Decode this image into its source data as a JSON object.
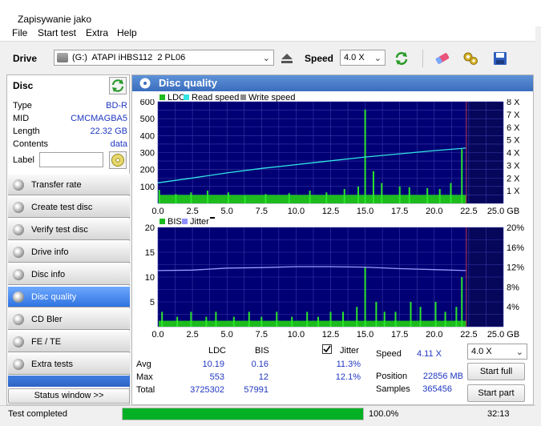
{
  "window": {
    "title": "Zapisywanie jako"
  },
  "menu": [
    "File",
    "Start test",
    "Extra",
    "Help"
  ],
  "toolbar": {
    "drive_label": "Drive",
    "drive_value": "(G:)  ATAPI iHBS112  2 PL06",
    "speed_label": "Speed",
    "speed_value": "4.0 X"
  },
  "disc": {
    "title": "Disc",
    "rows": [
      {
        "label": "Type",
        "value": "BD-R"
      },
      {
        "label": "MID",
        "value": "CMCMAGBA5"
      },
      {
        "label": "Length",
        "value": "22.32 GB"
      },
      {
        "label": "Contents",
        "value": "data"
      }
    ],
    "label_label": "Label",
    "label_value": ""
  },
  "nav": [
    {
      "label": "Transfer rate",
      "active": false
    },
    {
      "label": "Create test disc",
      "active": false
    },
    {
      "label": "Verify test disc",
      "active": false
    },
    {
      "label": "Drive info",
      "active": false
    },
    {
      "label": "Disc info",
      "active": false
    },
    {
      "label": "Disc quality",
      "active": true
    },
    {
      "label": "CD Bler",
      "active": false
    },
    {
      "label": "FE / TE",
      "active": false
    },
    {
      "label": "Extra tests",
      "active": false
    }
  ],
  "status_window_button": "Status window >>",
  "panel_title": "Disc quality",
  "chart_data": [
    {
      "type": "bar",
      "legend": [
        "LDC",
        "Read speed",
        "Write speed"
      ],
      "colors": {
        "LDC": "#1dbb1d",
        "Read speed": "#33e3e3",
        "Write speed": "#8a8a8a"
      },
      "x_ticks": [
        "0.0",
        "2.5",
        "5.0",
        "7.5",
        "10.0",
        "12.5",
        "15.0",
        "17.5",
        "20.0",
        "22.5",
        "25.0 GB"
      ],
      "y_ticks_left": [
        "600",
        "500",
        "400",
        "300",
        "200",
        "100"
      ],
      "y_ticks_right": [
        "8 X",
        "7 X",
        "6 X",
        "5 X",
        "4 X",
        "3 X",
        "2 X",
        "1 X"
      ],
      "xlim": [
        0,
        25
      ],
      "ylim": [
        0,
        600
      ],
      "y2lim": [
        0,
        8
      ],
      "data_end_gb": 22.32,
      "ldc_baseline_approx": 50,
      "ldc_spikes": [
        [
          0.1,
          80
        ],
        [
          1.3,
          55
        ],
        [
          2.4,
          65
        ],
        [
          3.6,
          75
        ],
        [
          5.1,
          65
        ],
        [
          6.3,
          45
        ],
        [
          7.8,
          55
        ],
        [
          9.5,
          60
        ],
        [
          11.0,
          75
        ],
        [
          12.2,
          65
        ],
        [
          13.5,
          85
        ],
        [
          14.5,
          100
        ],
        [
          15.0,
          553
        ],
        [
          15.6,
          190
        ],
        [
          16.2,
          120
        ],
        [
          17.5,
          100
        ],
        [
          18.2,
          95
        ],
        [
          19.5,
          90
        ],
        [
          20.4,
          85
        ],
        [
          21.2,
          120
        ],
        [
          22.0,
          320
        ]
      ],
      "read_speed_x": [
        0.0,
        2.5,
        5.0,
        7.5,
        10.0,
        12.5,
        15.0,
        17.5,
        20.0,
        22.32
      ],
      "read_speed_y": [
        1.62,
        2.0,
        2.4,
        2.75,
        3.05,
        3.35,
        3.65,
        3.9,
        4.15,
        4.35
      ],
      "series_note": ""
    },
    {
      "type": "bar",
      "legend": [
        "BIS",
        "Jitter"
      ],
      "colors": {
        "BIS": "#1dbb1d",
        "Jitter": "#8f8fff"
      },
      "x_ticks": [
        "0.0",
        "2.5",
        "5.0",
        "7.5",
        "10.0",
        "12.5",
        "15.0",
        "17.5",
        "20.0",
        "22.5",
        "25.0 GB"
      ],
      "y_ticks_left": [
        "20",
        "15",
        "10",
        "5"
      ],
      "y_ticks_right": [
        "20%",
        "16%",
        "12%",
        "8%",
        "4%"
      ],
      "xlim": [
        0,
        25
      ],
      "ylim": [
        0,
        20
      ],
      "y2lim": [
        0,
        20
      ],
      "bis_spikes": [
        [
          0.3,
          3
        ],
        [
          1.4,
          2
        ],
        [
          2.4,
          3
        ],
        [
          3.5,
          2
        ],
        [
          4.2,
          3
        ],
        [
          5.5,
          2
        ],
        [
          6.6,
          3
        ],
        [
          7.5,
          2
        ],
        [
          8.6,
          3
        ],
        [
          9.7,
          2
        ],
        [
          10.8,
          3
        ],
        [
          11.6,
          2
        ],
        [
          12.5,
          3
        ],
        [
          13.4,
          3
        ],
        [
          14.4,
          4
        ],
        [
          15.0,
          12
        ],
        [
          15.8,
          5
        ],
        [
          16.4,
          3
        ],
        [
          17.2,
          3
        ],
        [
          18.3,
          5
        ],
        [
          19.0,
          4
        ],
        [
          20.1,
          5
        ],
        [
          20.8,
          3
        ],
        [
          21.6,
          4
        ],
        [
          22.0,
          10
        ]
      ],
      "jitter_x": [
        0.0,
        2.5,
        5.0,
        7.5,
        10.0,
        12.5,
        15.0,
        17.5,
        20.0,
        22.32
      ],
      "jitter_y": [
        11.3,
        11.4,
        11.8,
        11.9,
        12.1,
        12.1,
        12.0,
        11.7,
        11.5,
        11.3
      ]
    }
  ],
  "stats": {
    "col_ldc": "LDC",
    "col_bis": "BIS",
    "jitter_label": "Jitter",
    "jitter_checked": true,
    "rows": [
      {
        "label": "Avg",
        "ldc": "10.19",
        "bis": "0.16",
        "jitter": "11.3%"
      },
      {
        "label": "Max",
        "ldc": "553",
        "bis": "12",
        "jitter": "12.1%"
      },
      {
        "label": "Total",
        "ldc": "3725302",
        "bis": "57991",
        "jitter": ""
      }
    ],
    "speed_label": "Speed",
    "speed_value": "4.11 X",
    "position_label": "Position",
    "position_value": "22856 MB",
    "samples_label": "Samples",
    "samples_value": "365456",
    "speed_select": "4.0 X",
    "start_full": "Start full",
    "start_part": "Start part"
  },
  "statusbar": {
    "text": "Test completed",
    "progress": 1.0,
    "progress_text": "100.0%",
    "time": "32:13"
  }
}
